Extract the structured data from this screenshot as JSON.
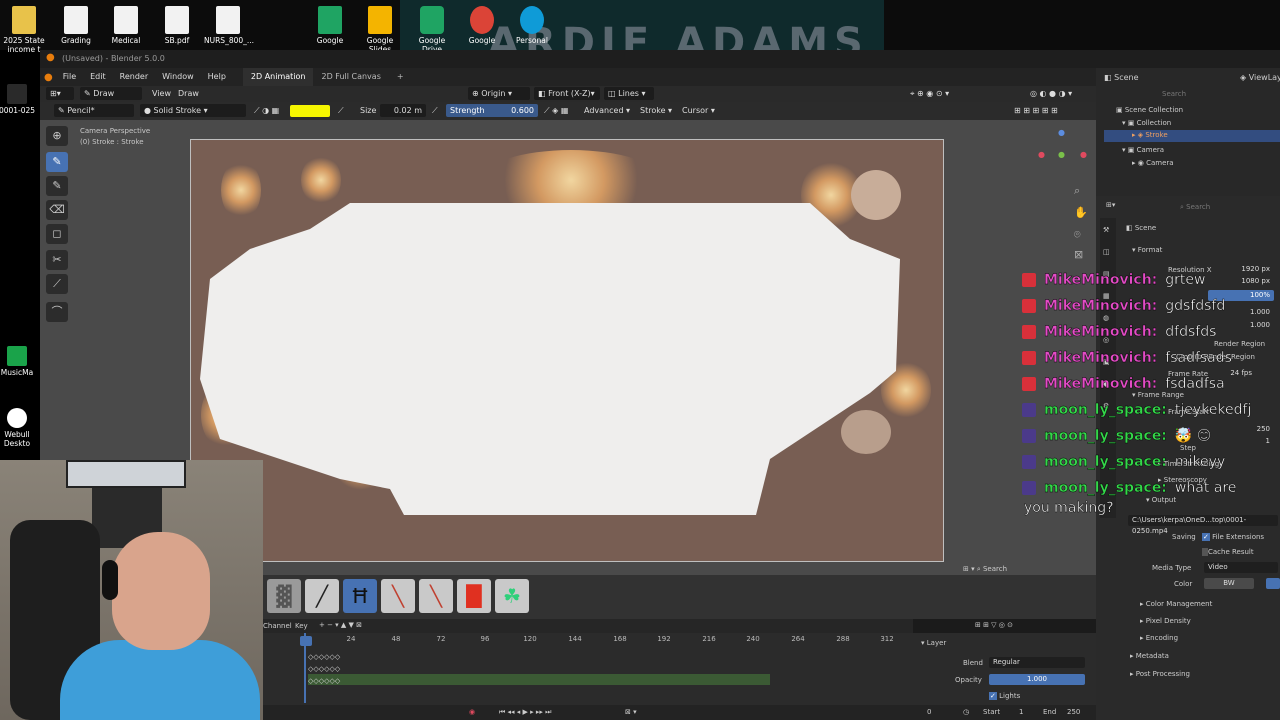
{
  "desktop": {
    "icons": [
      {
        "label": "2025 State income t",
        "color": "#e8c24a"
      },
      {
        "label": "Grading",
        "color": "#f2f2f2"
      },
      {
        "label": "Medical",
        "color": "#f2f2f2"
      },
      {
        "label": "SB.pdf",
        "color": "#f2f2f2"
      },
      {
        "label": "NURS_800_...",
        "color": "#f2f2f2"
      },
      {
        "label": "Google",
        "color": "#1fa463"
      },
      {
        "label": "Google Slides",
        "color": "#f4b400"
      },
      {
        "label": "Google Drive",
        "color": "#1fa463"
      },
      {
        "label": "Google",
        "color": "#db4437"
      },
      {
        "label": "Personal",
        "color": "#0f9bd7"
      }
    ],
    "left_icons": [
      {
        "label": "0001-025",
        "color": "#2a2a2a"
      },
      {
        "label": "MusicMa",
        "color": "#1aa34a"
      },
      {
        "label": "Webull Deskto",
        "color": "#ffffff"
      }
    ],
    "banner_text": "ARDIE ADAMS"
  },
  "blender": {
    "title": "(Unsaved) - Blender 5.0.0",
    "menus": [
      "File",
      "Edit",
      "Render",
      "Window",
      "Help"
    ],
    "workspace_tabs": [
      "2D Animation",
      "2D Full Canvas"
    ],
    "header": {
      "mode": "Draw Mode",
      "view": "View",
      "draw": "Draw",
      "origin": "Origin",
      "front": "Front (X-Z)",
      "lines": "Lines"
    },
    "tool_header": {
      "brush": "Pencil*",
      "material": "Solid Stroke",
      "size_label": "Size",
      "size_value": "0.02 m",
      "strength_label": "Strength",
      "strength_value": "0.600",
      "advanced": "Advanced",
      "stroke": "Stroke",
      "cursor": "Cursor",
      "color": "#f5f500"
    },
    "viewport": {
      "camera_text": "Camera Perspective",
      "object_text": "(0) Stroke : Stroke"
    },
    "outliner": {
      "scene": "Scene",
      "view_layer": "ViewLayer",
      "search_placeholder": "Search",
      "items": [
        "Scene Collection",
        "Collection",
        "Stroke",
        "Camera",
        "Camera"
      ]
    },
    "properties": {
      "search_placeholder": "Search",
      "scene": "Scene",
      "format": "Format",
      "resolution_x_label": "Resolution X",
      "resolution_x": "1920 px",
      "resolution_y": "1080 px",
      "percent": "100%",
      "aspect_x": "1.000",
      "aspect_y": "1.000",
      "render_region": "Render Region",
      "crop": "Crop to Render Region",
      "frame_rate_label": "Frame Rate",
      "frame_rate": "24 fps",
      "frame_range": "Frame Range",
      "frame_start": "Frame Start",
      "end_value": "250",
      "step_value": "1",
      "step": "Step",
      "time_stretching": "Time Stretching",
      "stereoscopy": "Stereoscopy",
      "output": "Output",
      "output_path": "C:\\Users\\kerpa\\OneD...top\\0001-0250.mp4",
      "saving": "Saving",
      "file_extensions": "File Extensions",
      "cache_result": "Cache Result",
      "media_type_label": "Media Type",
      "media_type": "Video",
      "color_label": "Color",
      "color_bw": "BW",
      "color_management": "Color Management",
      "pixel_density": "Pixel Density",
      "encoding": "Encoding",
      "metadata": "Metadata",
      "post_processing": "Post Processing"
    },
    "brushes": [
      {
        "glyph": "▓",
        "color": "#888888"
      },
      {
        "glyph": "╱",
        "color": "#222222"
      },
      {
        "glyph": "Ħ",
        "color": "#111111"
      },
      {
        "glyph": "╲",
        "color": "#c04030"
      },
      {
        "glyph": "╲",
        "color": "#c04030"
      },
      {
        "glyph": "█",
        "color": "#e03020"
      },
      {
        "glyph": "☘",
        "color": "#2fd07a"
      }
    ],
    "timeline": {
      "channel": "Channel",
      "key": "Key",
      "ticks": [
        "24",
        "48",
        "72",
        "96",
        "120",
        "144",
        "168",
        "192",
        "216",
        "240",
        "264",
        "288",
        "312"
      ],
      "current_frame": "0",
      "start_label": "Start",
      "start_value": "1",
      "end_label": "End",
      "end_value": "250"
    },
    "layer_panel": {
      "title": "Layer",
      "blend_label": "Blend",
      "blend_value": "Regular",
      "opacity_label": "Opacity",
      "opacity_value": "1.000",
      "lights": "Lights"
    }
  },
  "chat": {
    "messages": [
      {
        "user": "MikeMinovich:",
        "msg": "grtew",
        "user_color": "#e34cc6",
        "badge_color": "#d8303a"
      },
      {
        "user": "MikeMinovich:",
        "msg": "gdsfdsfd",
        "user_color": "#e34cc6",
        "badge_color": "#d8303a"
      },
      {
        "user": "MikeMinovich:",
        "msg": "dfdsfds",
        "user_color": "#e34cc6",
        "badge_color": "#d8303a"
      },
      {
        "user": "MikeMinovich:",
        "msg": "fsadfsads",
        "user_color": "#e34cc6",
        "badge_color": "#d8303a"
      },
      {
        "user": "MikeMinovich:",
        "msg": "fsdadfsa",
        "user_color": "#e34cc6",
        "badge_color": "#d8303a"
      },
      {
        "user": "moon_ly_space:",
        "msg": "tjeykekedfj",
        "user_color": "#34d84a",
        "badge_color": "#4b3a8a"
      },
      {
        "user": "moon_ly_space:",
        "msg": "🤯 😊",
        "user_color": "#34d84a",
        "badge_color": "#4b3a8a"
      },
      {
        "user": "moon_ly_space:",
        "msg": "mikeyy",
        "user_color": "#34d84a",
        "badge_color": "#4b3a8a"
      },
      {
        "user": "moon_ly_space:",
        "msg": "what are",
        "user_color": "#34d84a",
        "badge_color": "#4b3a8a"
      }
    ],
    "wrap": "you making?"
  }
}
